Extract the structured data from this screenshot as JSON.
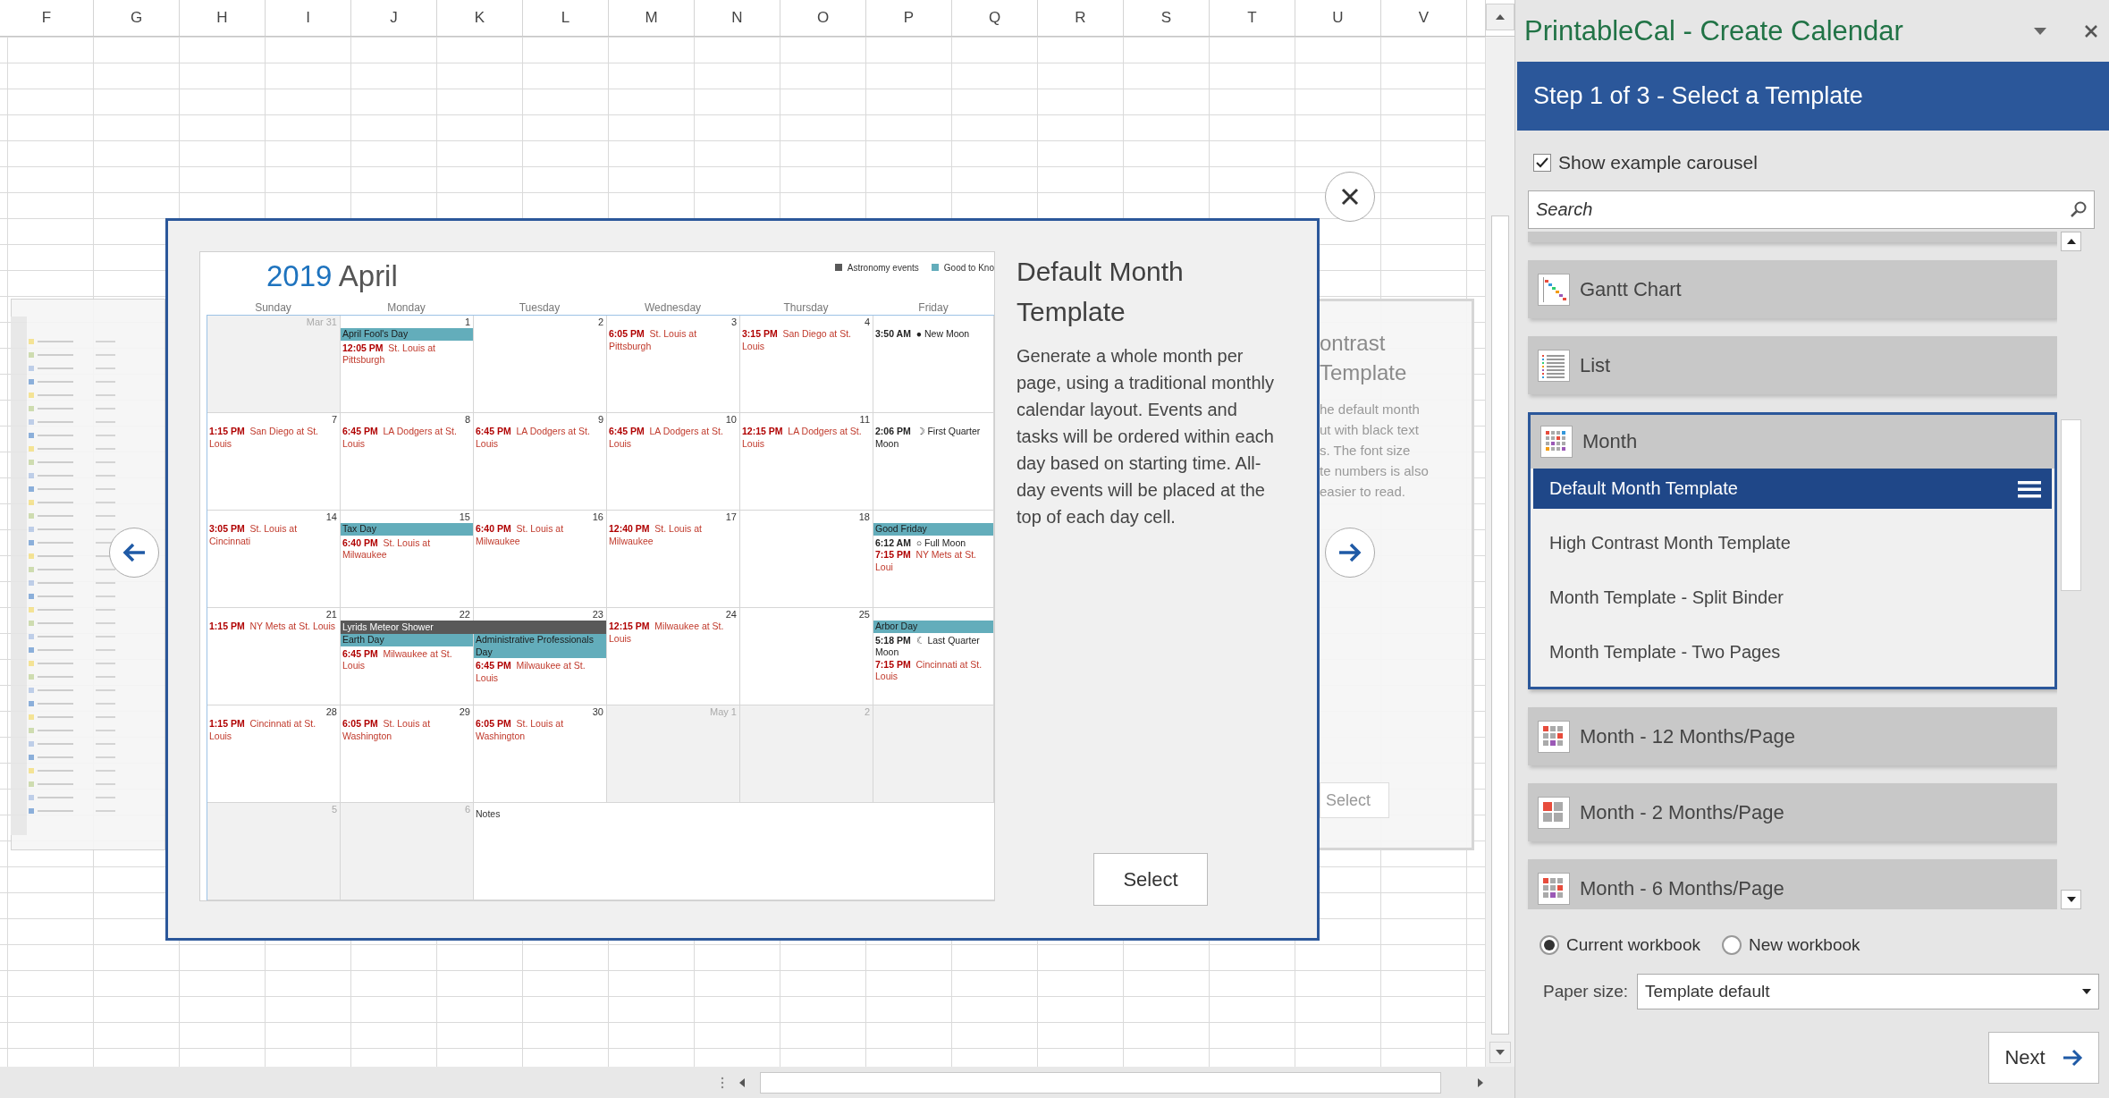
{
  "sheet": {
    "columns": [
      "F",
      "G",
      "H",
      "I",
      "J",
      "K",
      "L",
      "M",
      "N",
      "O",
      "P",
      "Q",
      "R",
      "S",
      "T",
      "U",
      "V"
    ]
  },
  "carousel": {
    "calendar": {
      "year": "2019",
      "month": "April",
      "legend": [
        {
          "label": "Astronomy events",
          "color": "#595959"
        },
        {
          "label": "Good to Kno",
          "color": "#63adbb"
        }
      ],
      "weekdays": [
        "Sunday",
        "Monday",
        "Tuesday",
        "Wednesday",
        "Thursday",
        "Friday"
      ],
      "weeks": [
        {
          "days": [
            {
              "date": "Mar 31",
              "outside": true
            },
            {
              "date": "1",
              "outside": false,
              "events": [
                {
                  "kind": "holiday",
                  "text": "April Fool's Day"
                },
                {
                  "kind": "game",
                  "text": "**12:05 PM**  St. Louis at Pittsburgh"
                }
              ]
            },
            {
              "date": "2",
              "outside": false
            },
            {
              "date": "3",
              "outside": false,
              "events": [
                {
                  "kind": "game",
                  "text": "**6:05 PM**  St. Louis at Pittsburgh"
                }
              ]
            },
            {
              "date": "4",
              "outside": false,
              "events": [
                {
                  "kind": "game",
                  "text": "**3:15 PM**  San Diego at St. Louis"
                }
              ]
            },
            {
              "outside": false,
              "events": [
                {
                  "kind": "astro",
                  "text": "**3:50 AM**  ● New Moon"
                }
              ]
            }
          ]
        },
        {
          "days": [
            {
              "date": "7",
              "outside": false,
              "events": [
                {
                  "kind": "game",
                  "text": "**1:15 PM**  San Diego at St. Louis"
                }
              ]
            },
            {
              "date": "8",
              "outside": false,
              "events": [
                {
                  "kind": "game",
                  "text": "**6:45 PM**  LA Dodgers at St. Louis"
                }
              ]
            },
            {
              "date": "9",
              "outside": false,
              "events": [
                {
                  "kind": "game",
                  "text": "**6:45 PM**  LA Dodgers at St. Louis"
                }
              ]
            },
            {
              "date": "10",
              "outside": false,
              "events": [
                {
                  "kind": "game",
                  "text": "**6:45 PM**  LA Dodgers at St. Louis"
                }
              ]
            },
            {
              "date": "11",
              "outside": false,
              "events": [
                {
                  "kind": "game",
                  "text": "**12:15 PM**  LA Dodgers at St. Louis"
                }
              ]
            },
            {
              "outside": false,
              "events": [
                {
                  "kind": "astro",
                  "text": "**2:06 PM**  ☽ First Quarter Moon"
                }
              ]
            }
          ]
        },
        {
          "days": [
            {
              "date": "14",
              "outside": false,
              "events": [
                {
                  "kind": "game",
                  "text": "**3:05 PM**  St. Louis at Cincinnati"
                }
              ]
            },
            {
              "date": "15",
              "outside": false,
              "events": [
                {
                  "kind": "holiday",
                  "text": "Tax Day"
                },
                {
                  "kind": "game",
                  "text": "**6:40 PM**  St. Louis at Milwaukee"
                }
              ]
            },
            {
              "date": "16",
              "outside": false,
              "events": [
                {
                  "kind": "game",
                  "text": "**6:40 PM**  St. Louis at Milwaukee"
                }
              ]
            },
            {
              "date": "17",
              "outside": false,
              "events": [
                {
                  "kind": "game",
                  "text": "**12:40 PM**  St. Louis at Milwaukee"
                }
              ]
            },
            {
              "date": "18",
              "outside": false
            },
            {
              "outside": false,
              "events": [
                {
                  "kind": "holiday",
                  "text": "Good Friday"
                },
                {
                  "kind": "astro",
                  "text": "**6:12 AM**  ○ Full Moon"
                },
                {
                  "kind": "game",
                  "text": "**7:15 PM**  NY Mets at St. Loui"
                }
              ]
            }
          ]
        },
        {
          "days": [
            {
              "date": "21",
              "outside": false,
              "events": [
                {
                  "kind": "game",
                  "text": "**1:15 PM**  NY Mets at St. Louis"
                }
              ]
            },
            {
              "date": "22",
              "outside": false,
              "events": [
                {
                  "kind": "two_day",
                  "text": "Lyrids Meteor Shower"
                },
                {
                  "kind": "holiday",
                  "text": "Earth Day"
                },
                {
                  "kind": "game",
                  "text": "**6:45 PM**  Milwaukee at St. Louis"
                }
              ]
            },
            {
              "date": "23",
              "outside": false,
              "events": [
                {
                  "kind": "continued"
                },
                {
                  "kind": "holiday",
                  "text": "Administrative Professionals Day"
                },
                {
                  "kind": "game",
                  "text": "**6:45 PM**  Milwaukee at St. Louis"
                }
              ]
            },
            {
              "date": "24",
              "outside": false,
              "events": [
                {
                  "kind": "game",
                  "text": "**12:15 PM**  Milwaukee at St. Louis"
                }
              ]
            },
            {
              "date": "25",
              "outside": false
            },
            {
              "outside": false,
              "events": [
                {
                  "kind": "holiday",
                  "text": "Arbor Day"
                },
                {
                  "kind": "astro",
                  "text": "**5:18 PM**  ☾ Last Quarter Moon"
                },
                {
                  "kind": "game",
                  "text": "**7:15 PM**  Cincinnati at St. Louis"
                }
              ]
            }
          ]
        },
        {
          "days": [
            {
              "date": "28",
              "outside": false,
              "events": [
                {
                  "kind": "game",
                  "text": "**1:15 PM**  Cincinnati at St. Louis"
                }
              ]
            },
            {
              "date": "29",
              "outside": false,
              "events": [
                {
                  "kind": "game",
                  "text": "**6:05 PM**  St. Louis at Washington"
                }
              ]
            },
            {
              "date": "30",
              "outside": false,
              "events": [
                {
                  "kind": "game",
                  "text": "**6:05 PM**  St. Louis at Washington"
                }
              ]
            },
            {
              "date": "May 1",
              "outside": true
            },
            {
              "date": "2",
              "outside": true
            },
            {
              "outside": true
            }
          ]
        }
      ],
      "notes_row": {
        "days": [
          {
            "date": "5",
            "outside": true
          },
          {
            "date": "6",
            "outside": true
          }
        ],
        "label": "Notes"
      }
    },
    "title": "Default Month Template",
    "description": "Generate a whole month per page, using a traditional monthly calendar layout. Events and tasks will be ordered within each day based on starting time. All-day events will be placed at the top of each day cell.",
    "select_button": "Select",
    "next_card": {
      "title_lines": [
        "ontrast",
        "Template"
      ],
      "text_lines": [
        "he default month",
        "ut with black text",
        "s. The font size",
        "te numbers is also",
        "easier to read."
      ],
      "select_button": "Select"
    }
  },
  "pane": {
    "title": "PrintableCal - Create Calendar",
    "step": "Step 1 of 3 - Select a Template",
    "show_carousel": {
      "label": "Show example carousel",
      "checked": true
    },
    "search": {
      "placeholder": "Search"
    },
    "categories": [
      {
        "kind": "partial"
      },
      {
        "kind": "category",
        "label": "Gantt Chart",
        "expanded": false
      },
      {
        "kind": "category",
        "label": "List",
        "expanded": false
      },
      {
        "kind": "category",
        "label": "Month",
        "expanded": true,
        "children": [
          {
            "label": "Default Month Template",
            "selected": true
          },
          {
            "label": "High Contrast Month Template",
            "selected": false
          },
          {
            "label": "Month Template - Split Binder",
            "selected": false
          },
          {
            "label": "Month Template - Two Pages",
            "selected": false
          }
        ]
      },
      {
        "kind": "category",
        "label": "Month - 12 Months/Page",
        "expanded": false
      },
      {
        "kind": "category",
        "label": "Month - 2 Months/Page",
        "expanded": false
      },
      {
        "kind": "category",
        "label": "Month - 6 Months/Page",
        "expanded": false
      }
    ],
    "destination": [
      {
        "label": "Current workbook",
        "selected": true
      },
      {
        "label": "New workbook",
        "selected": false
      }
    ],
    "paper_size": {
      "label": "Paper size:",
      "value": "Template default"
    },
    "next_button": "Next"
  }
}
